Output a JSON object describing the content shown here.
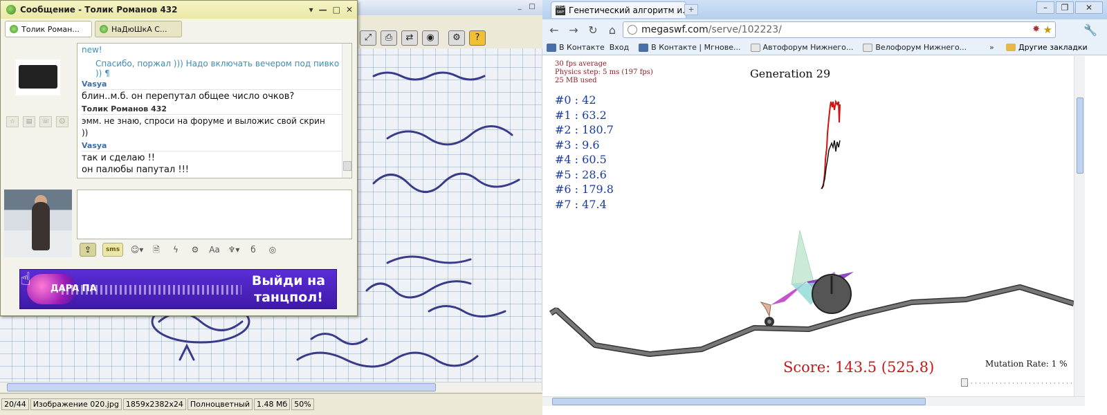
{
  "viewer": {
    "window_title": "",
    "status": [
      "20/44",
      "Изображение 020.jpg",
      "1859x2382x24",
      "Полноцветный",
      "1.48 Мб",
      "50%"
    ]
  },
  "chat": {
    "title": "Сообщение - Толик Романов 432",
    "tabs": [
      "Толик Роман...",
      "НаДюШкА С..."
    ],
    "messages": {
      "new_label": "new!",
      "quoted": "Спасибо, поржал ))) Надо включать вечером под пивко )) ¶",
      "m1_sender": "Vasya",
      "m1_text": "блин..м.б. он перепутал общее число очков?",
      "m2_sender": "Толик Романов 432",
      "m2_text": "эмм. не знаю, спроси на форуме и выложис свой скрин",
      "m2_text2": "))",
      "m3_sender": "Vasya",
      "m3_text": "так и сделаю !!",
      "m3_text2": "он палюбы папутал !!!"
    },
    "sms_label": "sms",
    "banner": {
      "logo": "ДАРА ПА",
      "cta_line1": "Выйди на",
      "cta_line2": "танцпол!"
    }
  },
  "browser": {
    "tab_title": "Генетический алгоритм и...",
    "url_host": "megaswf.com",
    "url_path": "/serve/102223/",
    "bookmarks": [
      "В Контакте",
      "Вход",
      "В Контакте | Мгнове...",
      "Автофорум Нижнего...",
      "Велофорум Нижнего..."
    ],
    "bookmarks_more": "»",
    "other_bookmarks": "Другие закладки"
  },
  "sim": {
    "fps_avg": "30 fps average",
    "physics": "Physics step: 5 ms (197 fps)",
    "memory": "25 MB used",
    "generation": "Generation 29",
    "scores": [
      "#0 : 42",
      "#1 : 63.2",
      "#2 : 180.7",
      "#3 : 9.6",
      "#4 : 60.5",
      "#5 : 28.6",
      "#6 : 179.8",
      "#7 : 47.4"
    ],
    "score": "Score: 143.5 (525.8)",
    "mutation": "Mutation Rate: 1 %",
    "mutation_rate_pct": 1
  },
  "colors": {
    "score_text": "#c51818",
    "stats_text": "#8a1a1a",
    "scores_text": "#1a3a9e",
    "banner": "#4a22c0"
  }
}
